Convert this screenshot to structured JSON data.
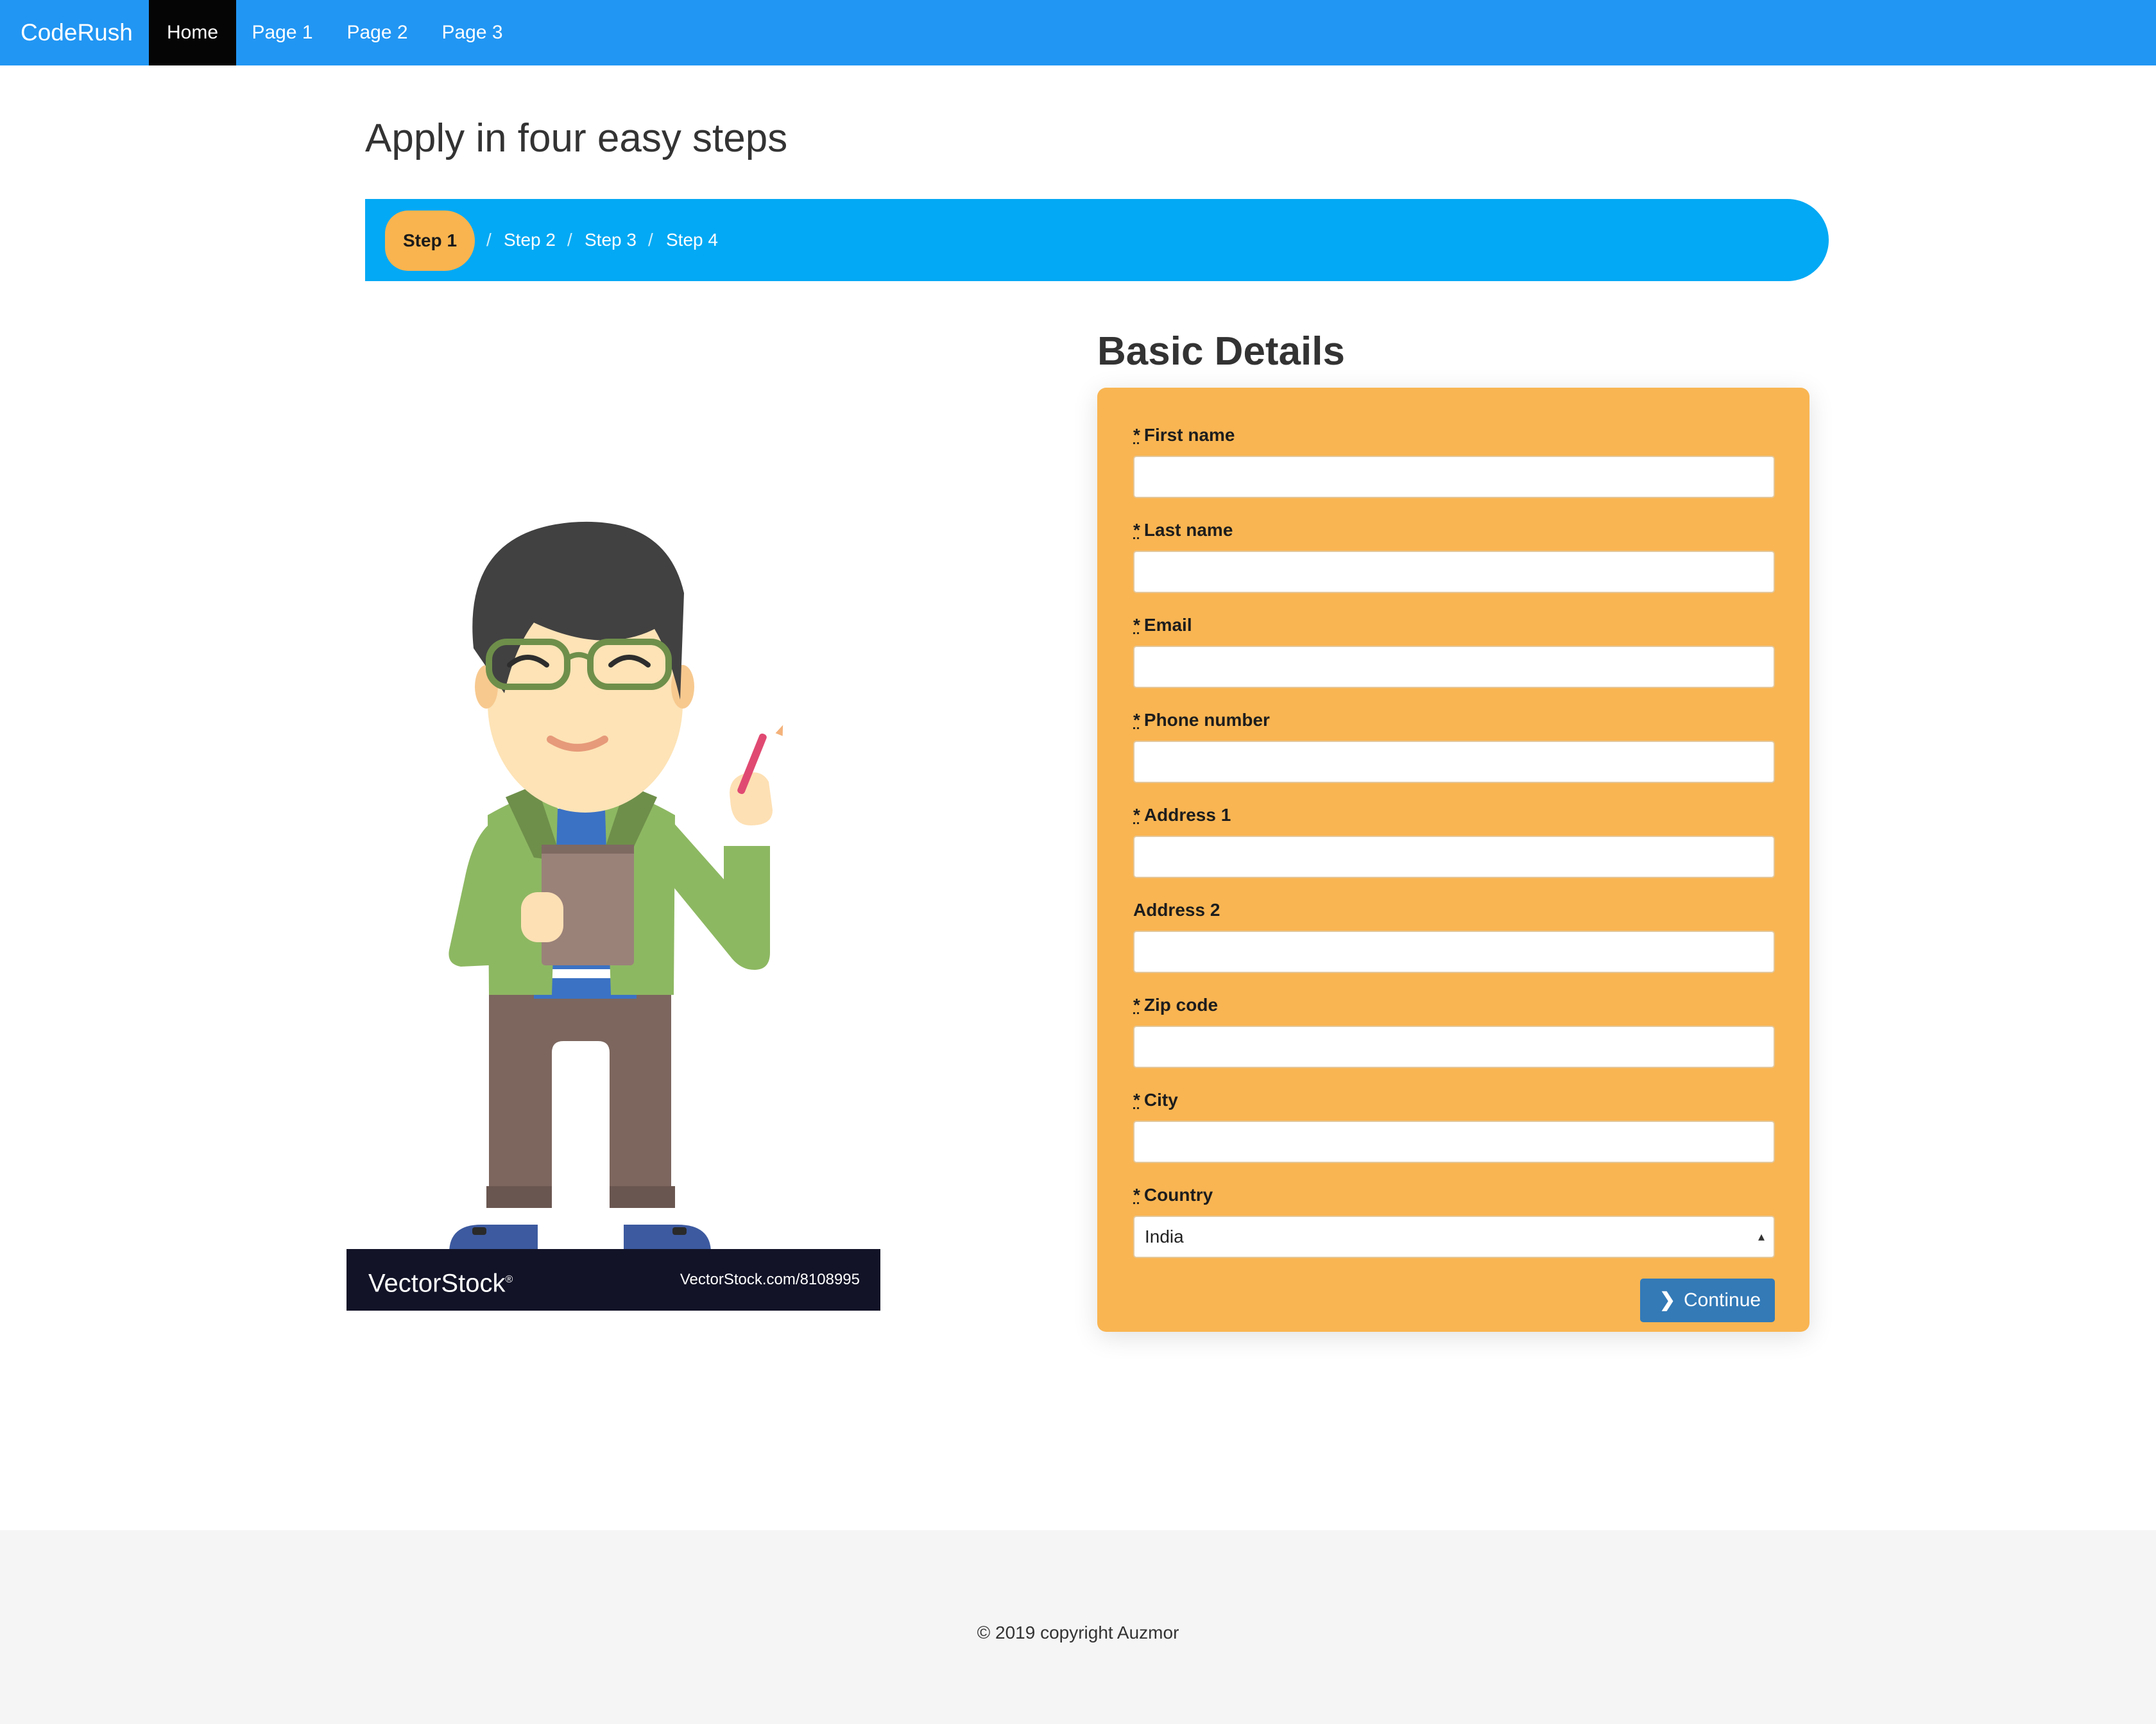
{
  "navbar": {
    "brand": "CodeRush",
    "items": [
      {
        "label": "Home",
        "active": true
      },
      {
        "label": "Page 1",
        "active": false
      },
      {
        "label": "Page 2",
        "active": false
      },
      {
        "label": "Page 3",
        "active": false
      }
    ]
  },
  "page": {
    "title": "Apply in four easy steps"
  },
  "stepper": {
    "separator": "/",
    "steps": [
      {
        "label": "Step 1",
        "active": true
      },
      {
        "label": "Step 2",
        "active": false
      },
      {
        "label": "Step 3",
        "active": false
      },
      {
        "label": "Step 4",
        "active": false
      }
    ]
  },
  "illustration": {
    "watermark_logo_light": "Vector",
    "watermark_logo_bold": "Stock",
    "watermark_reg": "®",
    "watermark_url": "VectorStock.com/8108995"
  },
  "form": {
    "title": "Basic Details",
    "required_marker": "*",
    "fields": [
      {
        "label": "First name",
        "required": true,
        "value": ""
      },
      {
        "label": "Last name",
        "required": true,
        "value": ""
      },
      {
        "label": "Email",
        "required": true,
        "value": ""
      },
      {
        "label": "Phone number",
        "required": true,
        "value": ""
      },
      {
        "label": "Address 1",
        "required": true,
        "value": ""
      },
      {
        "label": "Address 2",
        "required": false,
        "value": ""
      },
      {
        "label": "Zip code",
        "required": true,
        "value": ""
      },
      {
        "label": "City",
        "required": true,
        "value": ""
      },
      {
        "label": "Country",
        "required": true,
        "value": "India"
      }
    ],
    "continue_label": "Continue",
    "continue_icon": "chevron-right-icon"
  },
  "footer": {
    "text": "© 2019 copyright Auzmor"
  },
  "colors": {
    "navbar": "#2196f3",
    "stepper": "#03a9f4",
    "accent_orange": "#f9b552",
    "button": "#337ab7",
    "nav_active": "#050505"
  }
}
